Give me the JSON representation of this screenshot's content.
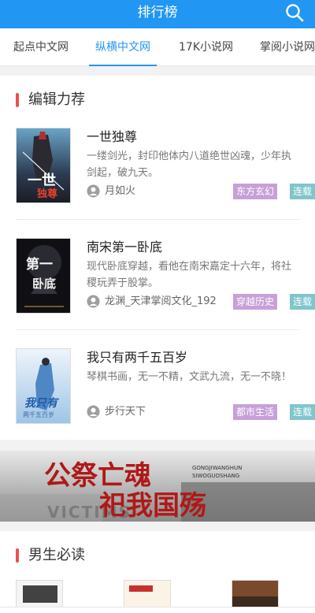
{
  "header": {
    "title": "排行榜"
  },
  "tabs": [
    {
      "label": "起点中文网"
    },
    {
      "label": "纵横中文网"
    },
    {
      "label": "17K小说网"
    },
    {
      "label": "掌阅小说网"
    }
  ],
  "editor_section": {
    "title": "编辑力荐",
    "books": [
      {
        "title": "一世独尊",
        "desc": "一缕剑光，封印他体内八道绝世凶魂，少年执剑起，破九天。",
        "author": "月如火",
        "genre": "东方玄幻",
        "status": "连载",
        "genre_color": "#c7a0d8",
        "status_color": "#7fc6cc"
      },
      {
        "title": "南宋第一卧底",
        "desc": "现代卧底穿越，看他在南宋嘉定十六年，将社稷玩弄于股掌。",
        "author": "龙渊_天津掌阅文化_192",
        "genre": "穿越历史",
        "status": "连载",
        "genre_color": "#c7a0d8",
        "status_color": "#7fc6cc"
      },
      {
        "title": "我只有两千五百岁",
        "desc": "琴棋书画，无一不精，文武九流，无一不晓！",
        "author": "步行天下",
        "genre": "都市生活",
        "status": "连载",
        "genre_color": "#c7a0d8",
        "status_color": "#7fc6cc"
      }
    ],
    "covers": [
      {
        "text_main": "一世",
        "text_sub": "独尊"
      },
      {
        "text_main": "第一",
        "text_sub": "卧底"
      },
      {
        "text_main": "我只有",
        "text_sub": "两千五百岁"
      }
    ]
  },
  "banner": {
    "headline_1": "公祭亡魂",
    "headline_2": "祀我国殇",
    "pinyin_1": "GONGJIWANGHUN",
    "pinyin_2": "SIWOGUOSHANG",
    "background_text": "VICTIMS"
  },
  "male_section": {
    "title": "男生必读"
  },
  "colors": {
    "accent": "#2196f3",
    "section_marker": "#e85050"
  }
}
